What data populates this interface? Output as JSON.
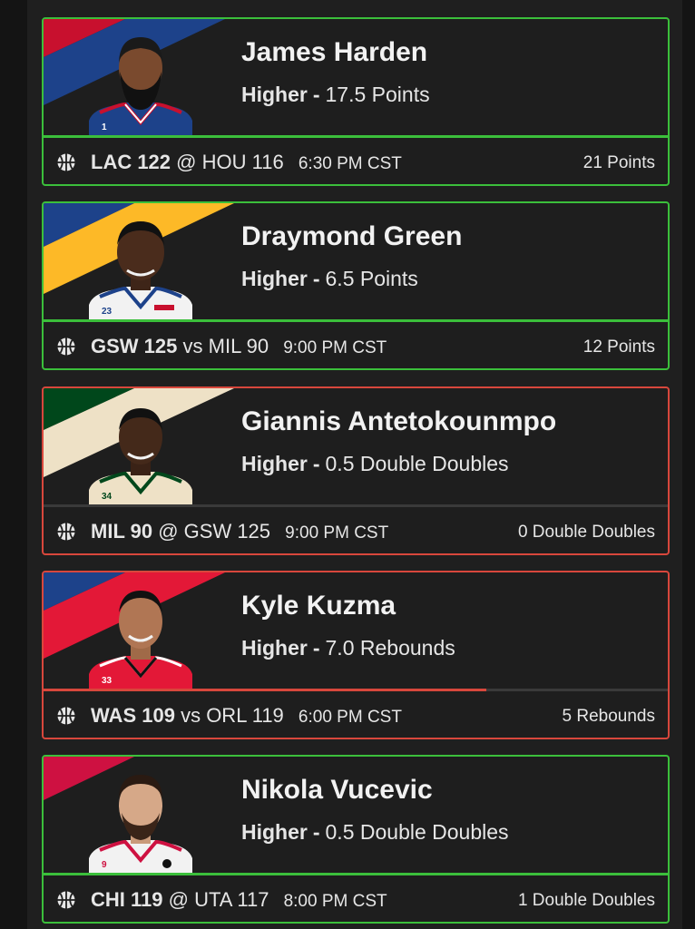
{
  "colors": {
    "win_border": "#3bbf3b",
    "loss_border": "#d8473c"
  },
  "cards": [
    {
      "player": "James Harden",
      "direction": "Higher",
      "line": "17.5 Points",
      "team1": "LAC 122",
      "connector": "@",
      "team2": "HOU 116",
      "time": "6:30 PM CST",
      "result": "21 Points",
      "status": "win",
      "jersey_number": "1",
      "progress": 1.0
    },
    {
      "player": "Draymond Green",
      "direction": "Higher",
      "line": "6.5 Points",
      "team1": "GSW 125",
      "connector": "vs",
      "team2": "MIL 90",
      "time": "9:00 PM CST",
      "result": "12 Points",
      "status": "win",
      "jersey_number": "23",
      "progress": 1.0
    },
    {
      "player": "Giannis Antetokounmpo",
      "direction": "Higher",
      "line": "0.5 Double Doubles",
      "team1": "MIL 90",
      "connector": "@",
      "team2": "GSW 125",
      "time": "9:00 PM CST",
      "result": "0 Double Doubles",
      "status": "loss",
      "jersey_number": "34",
      "progress": 0.0
    },
    {
      "player": "Kyle Kuzma",
      "direction": "Higher",
      "line": "7.0 Rebounds",
      "team1": "WAS 109",
      "connector": "vs",
      "team2": "ORL 119",
      "time": "6:00 PM CST",
      "result": "5 Rebounds",
      "status": "loss",
      "jersey_number": "33",
      "progress": 0.71
    },
    {
      "player": "Nikola Vucevic",
      "direction": "Higher",
      "line": "0.5 Double Doubles",
      "team1": "CHI 119",
      "connector": "@",
      "team2": "UTA 117",
      "time": "8:00 PM CST",
      "result": "1 Double Doubles",
      "status": "win",
      "jersey_number": "9",
      "progress": 1.0
    }
  ]
}
